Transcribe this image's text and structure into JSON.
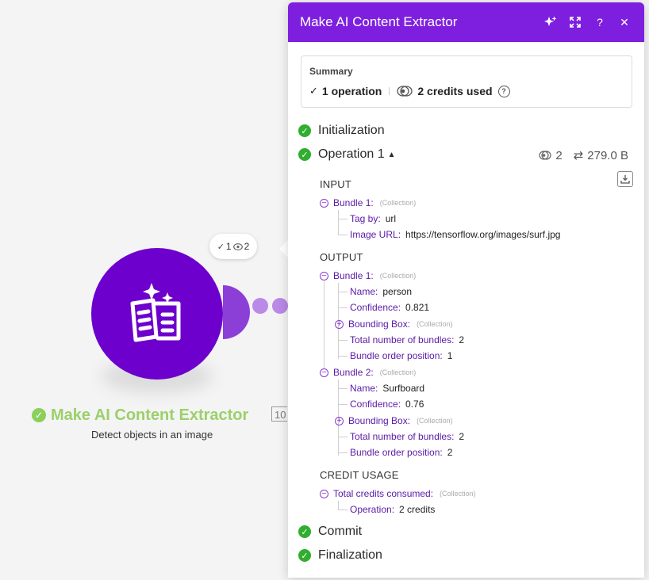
{
  "node": {
    "title": "Make AI Content Extractor",
    "subtitle": "Detect objects in an image",
    "id_badge": "10",
    "bubble_ops": "1",
    "bubble_credits": "2",
    "colors": {
      "module": "#6d00cc",
      "title": "#9bd06b",
      "header": "#7e1fe0",
      "success": "#2fae2f"
    }
  },
  "panel": {
    "title": "Make AI Content Extractor",
    "header_icons": [
      "sparkle-icon",
      "expand-icon",
      "help-icon",
      "close-icon"
    ],
    "header_help": "?",
    "header_close": "✕",
    "summary": {
      "label": "Summary",
      "operations": "1 operation",
      "credits": "2 credits used"
    },
    "phases": {
      "initialization": "Initialization",
      "operation": "Operation 1",
      "commit": "Commit",
      "finalization": "Finalization"
    },
    "operation_meta": {
      "credits": "2",
      "size": "279.0 B"
    },
    "input": {
      "heading": "INPUT",
      "bundle_label": "Bundle 1:",
      "collection": "(Collection)",
      "fields": [
        {
          "key": "Tag by:",
          "value": "url"
        },
        {
          "key": "Image URL:",
          "value": "https://tensorflow.org/images/surf.jpg"
        }
      ]
    },
    "output": {
      "heading": "OUTPUT",
      "collection": "(Collection)",
      "bundles": [
        {
          "label": "Bundle 1:",
          "name_key": "Name:",
          "name": "person",
          "conf_key": "Confidence:",
          "confidence": "0.821",
          "bbox_key": "Bounding Box:",
          "total_key": "Total number of bundles:",
          "total": "2",
          "order_key": "Bundle order position:",
          "order": "1"
        },
        {
          "label": "Bundle 2:",
          "name_key": "Name:",
          "name": "Surfboard",
          "conf_key": "Confidence:",
          "confidence": "0.76",
          "bbox_key": "Bounding Box:",
          "total_key": "Total number of bundles:",
          "total": "2",
          "order_key": "Bundle order position:",
          "order": "2"
        }
      ]
    },
    "credit_usage": {
      "heading": "CREDIT USAGE",
      "label": "Total credits consumed:",
      "collection": "(Collection)",
      "op_key": "Operation:",
      "op_value": "2 credits"
    }
  }
}
